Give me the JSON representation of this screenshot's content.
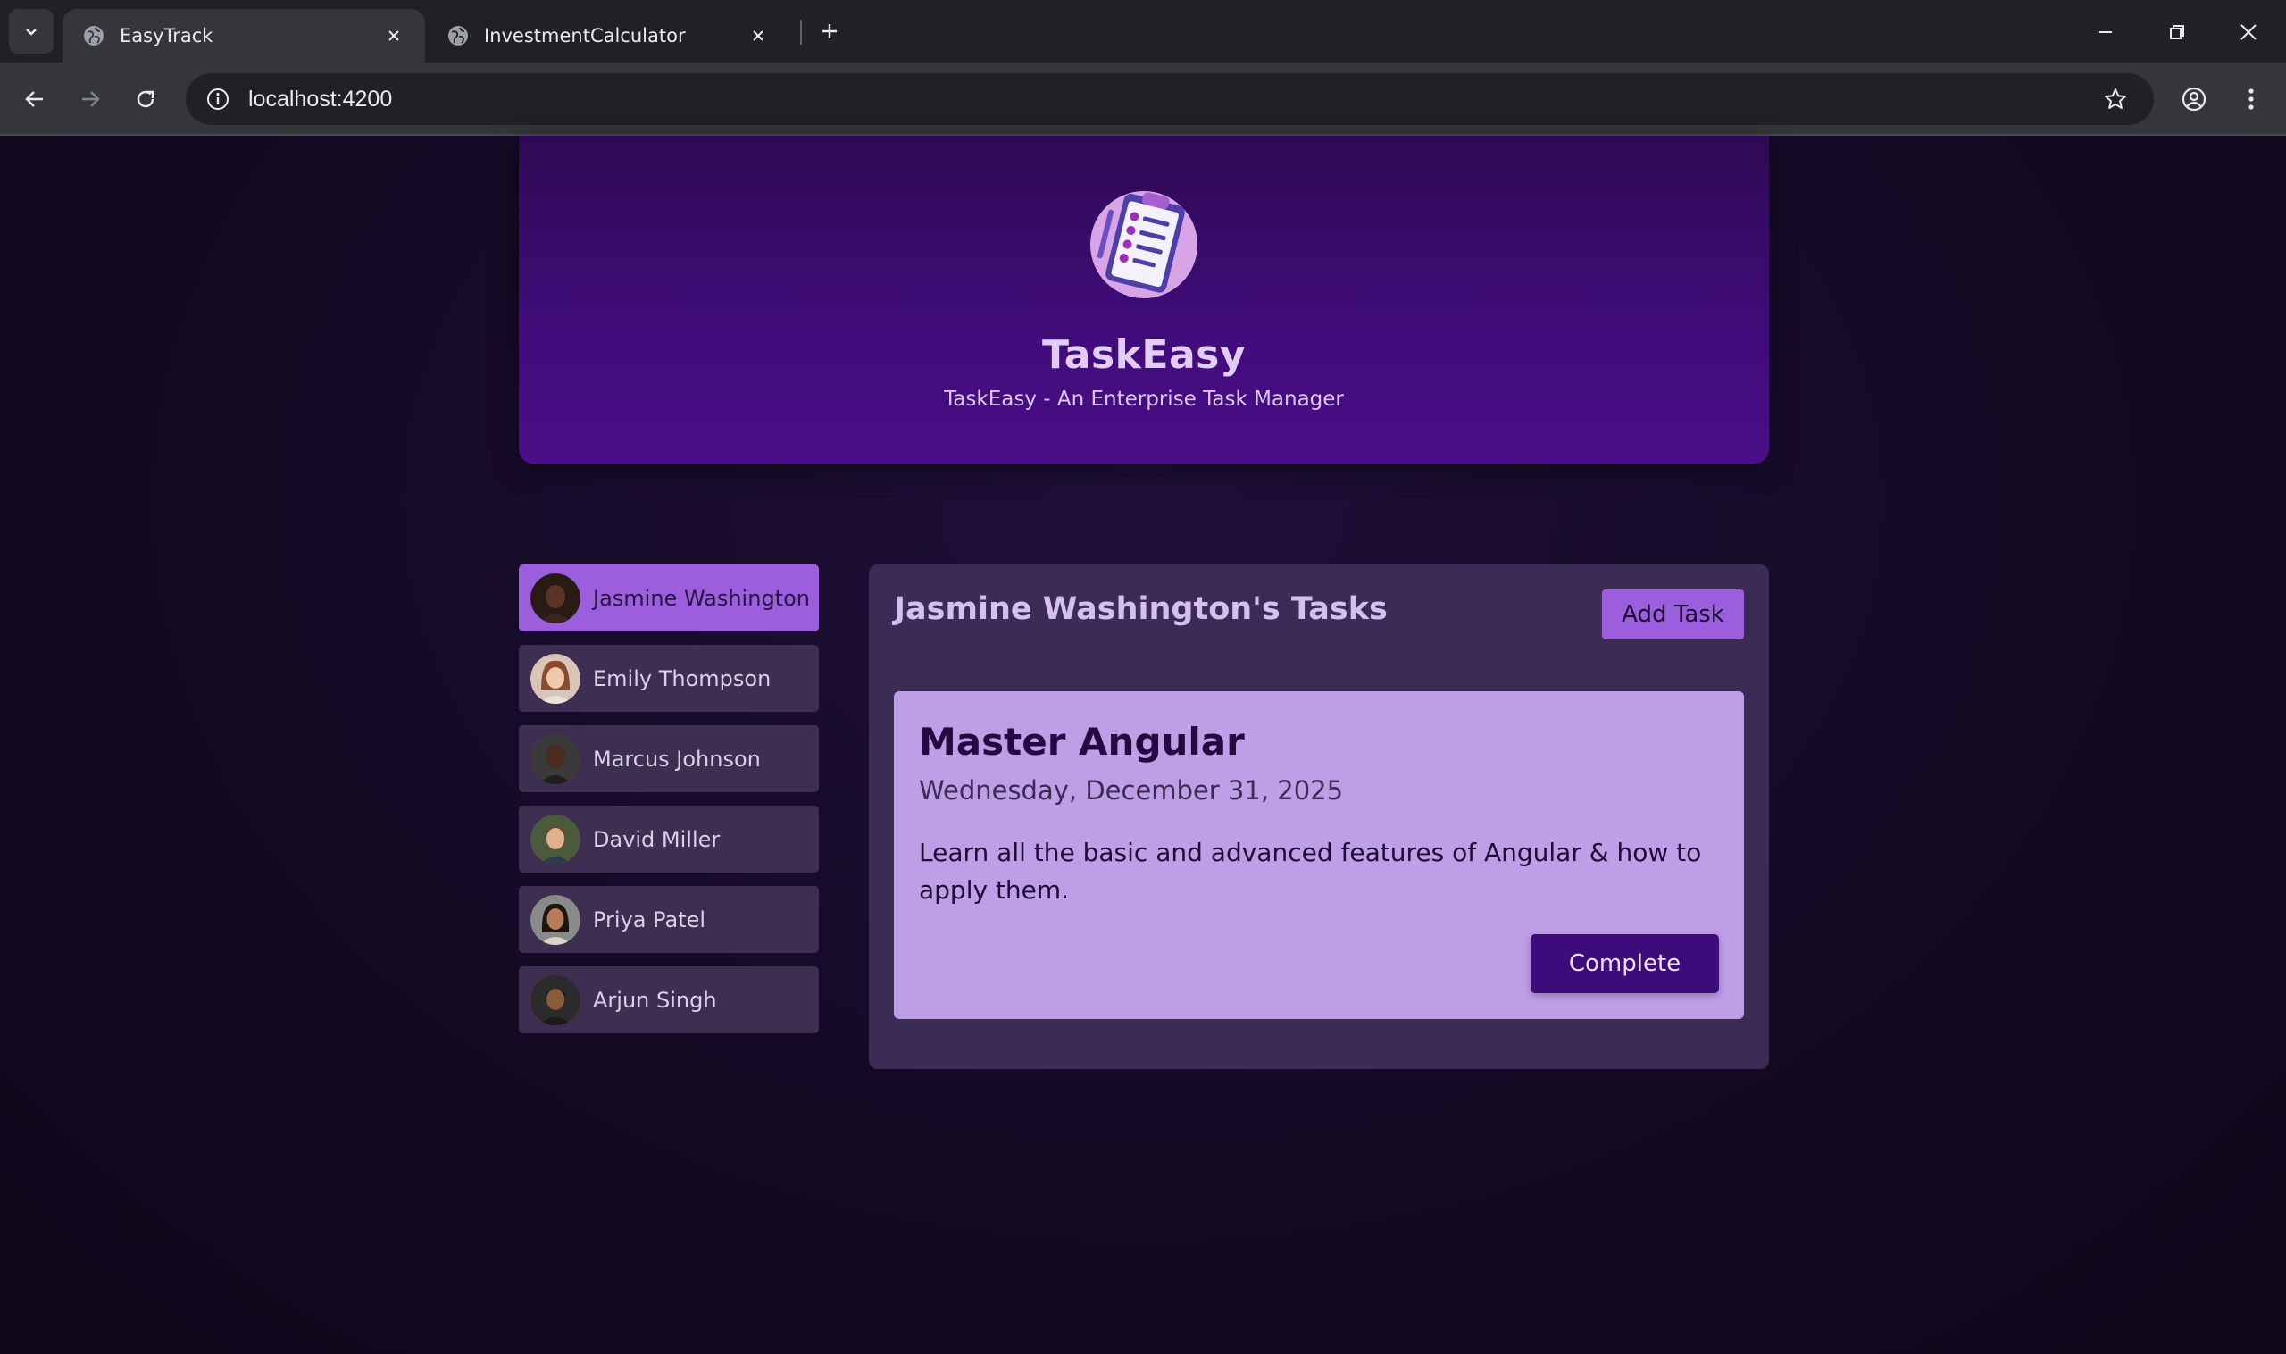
{
  "browser": {
    "tabs": [
      {
        "title": "EasyTrack",
        "active": true
      },
      {
        "title": "InvestmentCalculator",
        "active": false
      }
    ],
    "url": "localhost:4200"
  },
  "header": {
    "title": "TaskEasy",
    "subtitle": "TaskEasy - An Enterprise Task Manager"
  },
  "users": [
    {
      "name": "Jasmine Washington",
      "selected": true
    },
    {
      "name": "Emily Thompson",
      "selected": false
    },
    {
      "name": "Marcus Johnson",
      "selected": false
    },
    {
      "name": "David Miller",
      "selected": false
    },
    {
      "name": "Priya Patel",
      "selected": false
    },
    {
      "name": "Arjun Singh",
      "selected": false
    }
  ],
  "tasks_panel": {
    "title": "Jasmine Washington's Tasks",
    "add_label": "Add Task"
  },
  "task": {
    "title": "Master Angular",
    "date": "Wednesday, December 31, 2025",
    "summary": "Learn all the basic and advanced features of Angular & how to apply them.",
    "complete_label": "Complete"
  },
  "colors": {
    "accent": "#9b5fde",
    "card": "#be9ee6",
    "complete_button": "#3d0b7a",
    "header": "#3f0c78"
  }
}
